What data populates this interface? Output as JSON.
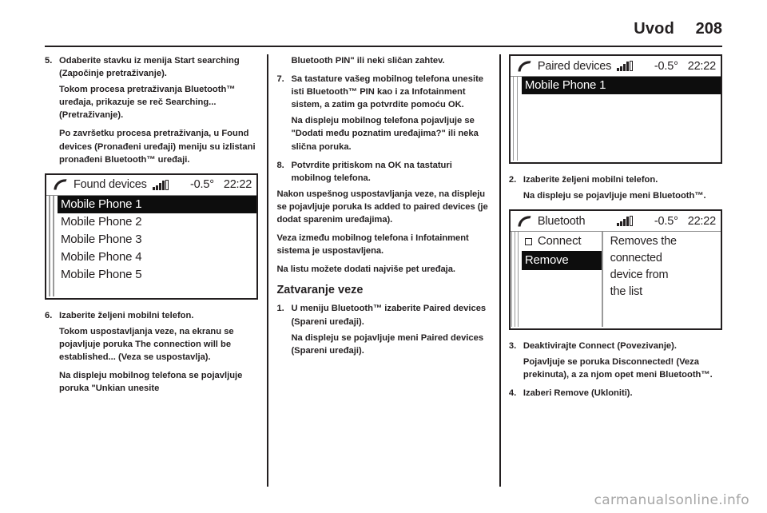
{
  "header": {
    "title": "Uvod",
    "page_number": "208"
  },
  "watermark": "carmanualsonline.info",
  "columns": {
    "left": {
      "blocks": [
        {
          "kind": "step",
          "num": "5.",
          "text": "Odaberite stavku iz menija Start searching (Započinje pretraživanje)."
        },
        {
          "kind": "sub",
          "text": "Tokom procesa pretraživanja Bluetooth™ uređaja, prikazuje se reč Searching... (Pretraživanje)."
        },
        {
          "kind": "sub",
          "text": "Po završetku procesa pretraživanja, u Found devices (Pronađeni uređaji) meniju su izlistani pronađeni Bluetooth™ uređaji."
        },
        {
          "kind": "step",
          "num": "6.",
          "text": "Izaberite željeni mobilni telefon."
        },
        {
          "kind": "sub",
          "text": "Tokom uspostavljanja veze, na ekranu se pojavljuje poruka The connection will be established... (Veza se uspostavlja)."
        },
        {
          "kind": "sub",
          "text": "Na displeju mobilnog telefona se pojavljuje poruka \"Unkian unesite"
        }
      ]
    },
    "middle": {
      "blocks": [
        {
          "kind": "sub",
          "text": "Bluetooth PIN\" ili neki sličan zahtev."
        },
        {
          "kind": "step",
          "num": "7.",
          "text": "Sa tastature vašeg mobilnog telefona unesite isti Bluetooth™ PIN kao i za Infotainment sistem, a zatim ga potvrdite pomoću OK."
        },
        {
          "kind": "sub",
          "text": "Na displeju mobilnog telefona pojavljuje se \"Dodati među poznatim uređajima?\" ili neka slična poruka."
        },
        {
          "kind": "step",
          "num": "8.",
          "text": "Potvrdite pritiskom na OK na tastaturi mobilnog telefona."
        },
        {
          "kind": "para",
          "text": "Nakon uspešnog uspostavljanja veze, na displeju se pojavljuje poruka Is added to paired devices (je dodat sparenim uređajima)."
        },
        {
          "kind": "para",
          "text": "Veza između mobilnog telefona i Infotainment sistema je uspostavljena."
        },
        {
          "kind": "para",
          "text": "Na listu možete dodati najviše pet uređaja."
        },
        {
          "kind": "heading",
          "text": "Zatvaranje veze"
        },
        {
          "kind": "step",
          "num": "1.",
          "text": "U meniju Bluetooth™ izaberite Paired devices (Spareni uređaji)."
        },
        {
          "kind": "sub",
          "text": "Na displeju se pojavljuje meni Paired devices (Spareni uređaji)."
        }
      ]
    },
    "right": {
      "blocks": [
        {
          "kind": "step",
          "num": "2.",
          "text": "Izaberite željeni mobilni telefon."
        },
        {
          "kind": "sub",
          "text": "Na displeju se pojavljuje meni Bluetooth™."
        },
        {
          "kind": "step",
          "num": "3.",
          "text": "Deaktivirajte Connect (Povezivanje)."
        },
        {
          "kind": "sub",
          "text": "Pojavljuje se poruka Disconnected! (Veza prekinuta), a za njom opet meni Bluetooth™."
        },
        {
          "kind": "step",
          "num": "4.",
          "text": "Izaberi Remove (Ukloniti)."
        }
      ]
    }
  },
  "displays": {
    "found_devices": {
      "icon": "phone-handset-icon",
      "title": "Found devices",
      "signal": "signal-bars-icon",
      "temperature": "-0.5°",
      "clock": "22:22",
      "rows": [
        {
          "label": "Mobile Phone 1",
          "selected": true
        },
        {
          "label": "Mobile Phone 2",
          "selected": false
        },
        {
          "label": "Mobile Phone 3",
          "selected": false
        },
        {
          "label": "Mobile Phone 4",
          "selected": false
        },
        {
          "label": "Mobile Phone 5",
          "selected": false
        }
      ]
    },
    "paired_devices": {
      "icon": "phone-handset-icon",
      "title": "Paired devices",
      "signal": "signal-bars-icon",
      "temperature": "-0.5°",
      "clock": "22:22",
      "rows": [
        {
          "label": "Mobile Phone 1",
          "selected": true
        }
      ]
    },
    "bluetooth": {
      "icon": "phone-handset-icon",
      "title": "Bluetooth",
      "signal": "signal-bars-icon",
      "temperature": "-0.5°",
      "clock": "22:22",
      "menu": [
        {
          "label": "Connect",
          "checkbox": true,
          "selected": false
        },
        {
          "label": "Remove",
          "checkbox": false,
          "selected": true
        }
      ],
      "description_lines": [
        "Removes the",
        "connected",
        "device from",
        "the list"
      ]
    }
  }
}
